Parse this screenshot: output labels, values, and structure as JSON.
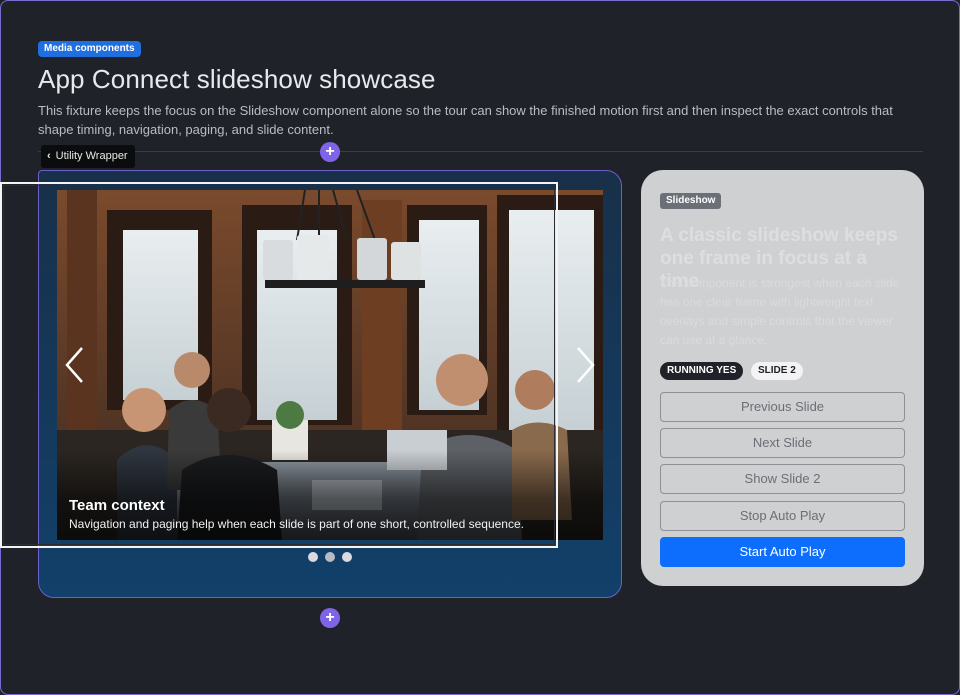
{
  "header": {
    "badge": "Media components",
    "title": "App Connect slideshow showcase",
    "description": "This fixture keeps the focus on the Slideshow component alone so the tour can show the finished motion first and then inspect the exact controls that shape timing, navigation, paging, and slide content."
  },
  "editor": {
    "utility_label": "Utility Wrapper",
    "add_above_icon": "plus-icon",
    "add_below_icon": "plus-icon",
    "back_icon": "chevron-left-icon"
  },
  "slideshow": {
    "current_slide": {
      "title": "Team context",
      "text": "Navigation and paging help when each slide is part of one short, controlled sequence."
    },
    "prev_icon": "chevron-left-icon",
    "next_icon": "chevron-right-icon",
    "dot_count": 3,
    "active_dot": 2
  },
  "panel": {
    "tag": "Slideshow",
    "heading": "A classic slideshow keeps one frame in focus at a time",
    "body": "This component is strongest when each slide has one clear frame with lightweight text overlays and simple controls that the viewer can use at a glance.",
    "status": {
      "running": "RUNNING YES",
      "slide": "SLIDE 2"
    },
    "buttons": {
      "previous": "Previous Slide",
      "next": "Next Slide",
      "show2": "Show Slide 2",
      "stop": "Stop Auto Play",
      "start": "Start Auto Play"
    }
  },
  "colors": {
    "accent": "#7f64e8",
    "primary_button": "#0d6efd",
    "badge": "#1f6fe0"
  }
}
